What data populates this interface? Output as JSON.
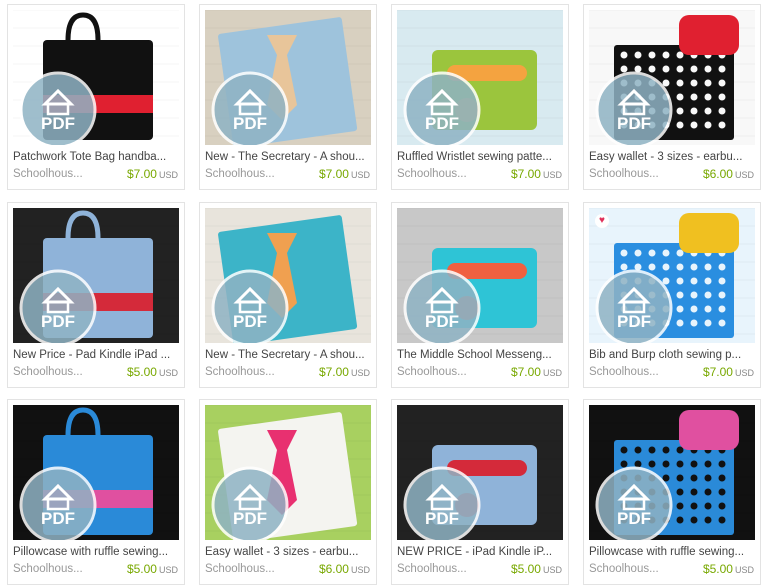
{
  "listings": [
    {
      "title": "Patchwork Tote Bag handba...",
      "shop": "Schoolhous...",
      "price": "$7.00",
      "currency": "USD",
      "colors": [
        "#111111",
        "#e02030",
        "#ffffff"
      ]
    },
    {
      "title": "New - The Secretary - A shou...",
      "shop": "Schoolhous...",
      "price": "$7.00",
      "currency": "USD",
      "colors": [
        "#9ec3dc",
        "#e8c59a",
        "#d8d0c0"
      ]
    },
    {
      "title": "Ruffled Wristlet sewing patte...",
      "shop": "Schoolhous...",
      "price": "$7.00",
      "currency": "USD",
      "colors": [
        "#9bc53d",
        "#f4a340",
        "#d8eaf0"
      ]
    },
    {
      "title": "Easy wallet - 3 sizes - earbu...",
      "shop": "Schoolhous...",
      "price": "$6.00",
      "currency": "USD",
      "colors": [
        "#111111",
        "#e02030",
        "#f8f8f8"
      ]
    },
    {
      "title": "New Price - Pad Kindle iPad ...",
      "shop": "Schoolhous...",
      "price": "$5.00",
      "currency": "USD",
      "colors": [
        "#8fb3d9",
        "#d42a3a",
        "#222222"
      ]
    },
    {
      "title": "New - The Secretary - A shou...",
      "shop": "Schoolhous...",
      "price": "$7.00",
      "currency": "USD",
      "colors": [
        "#3cb4c8",
        "#f0a050",
        "#e8e4dc"
      ]
    },
    {
      "title": "The Middle School Messeng...",
      "shop": "Schoolhous...",
      "price": "$7.00",
      "currency": "USD",
      "colors": [
        "#2ec4d6",
        "#f06040",
        "#c8c8c8"
      ]
    },
    {
      "title": "Bib and Burp cloth sewing p...",
      "shop": "Schoolhous...",
      "price": "$7.00",
      "currency": "USD",
      "colors": [
        "#2a8ee0",
        "#f0c020",
        "#e8f4fc"
      ],
      "favorited": true
    },
    {
      "title": "Pillowcase with ruffle sewing...",
      "shop": "Schoolhous...",
      "price": "$5.00",
      "currency": "USD",
      "colors": [
        "#2a8ad8",
        "#e050a0",
        "#111111"
      ]
    },
    {
      "title": "Easy wallet - 3 sizes - earbu...",
      "shop": "Schoolhous...",
      "price": "$6.00",
      "currency": "USD",
      "colors": [
        "#f4f4f0",
        "#e83070",
        "#a8d060"
      ]
    },
    {
      "title": "NEW PRICE - iPad Kindle iP...",
      "shop": "Schoolhous...",
      "price": "$5.00",
      "currency": "USD",
      "colors": [
        "#8fb3d9",
        "#d42a3a",
        "#222222"
      ]
    },
    {
      "title": "Pillowcase with ruffle sewing...",
      "shop": "Schoolhous...",
      "price": "$5.00",
      "currency": "USD",
      "colors": [
        "#2a8ad8",
        "#e050a0",
        "#111111"
      ]
    }
  ],
  "badge": {
    "text": "PDF",
    "color": "#8fb3c4"
  },
  "icons": {
    "favorite": "heart-icon",
    "badge": "schoolhouse-logo-icon"
  }
}
